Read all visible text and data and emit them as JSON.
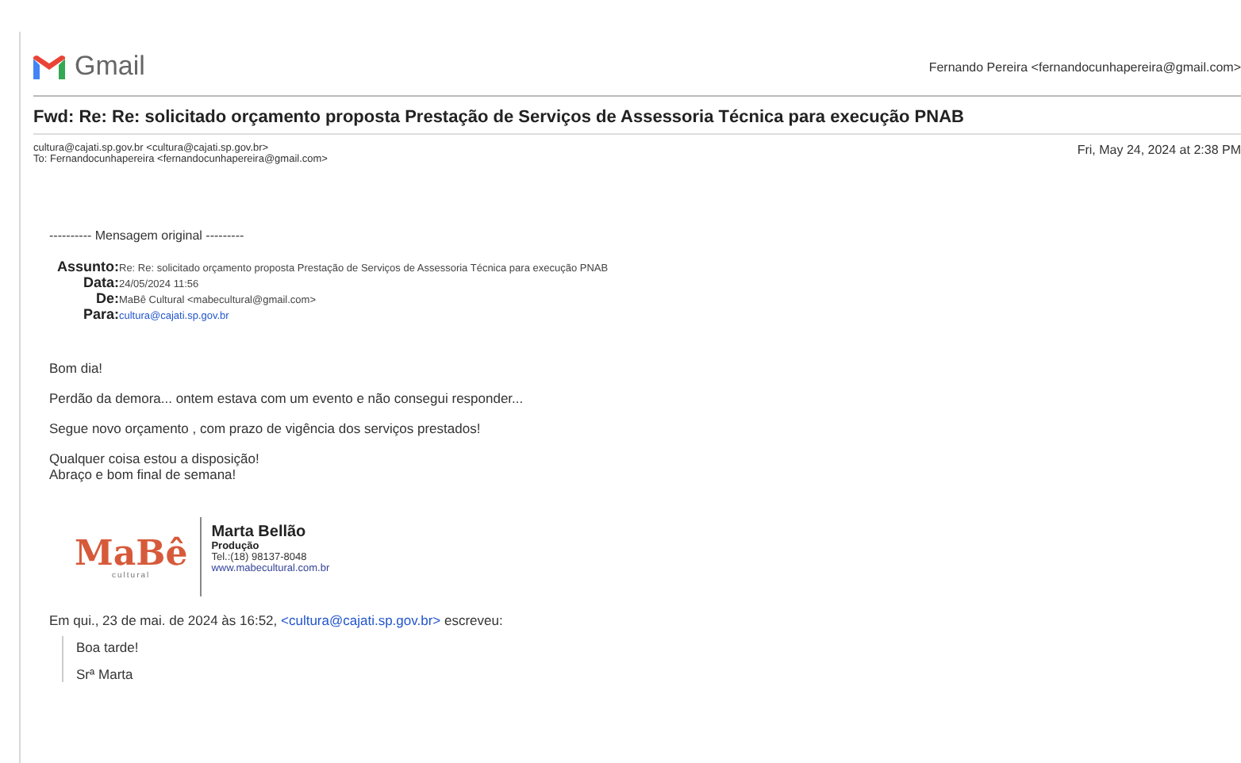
{
  "header": {
    "brand": "Gmail",
    "account": "Fernando Pereira <fernandocunhapereira@gmail.com>"
  },
  "subject": "Fwd: Re: Re: solicitado orçamento proposta Prestação de Serviços de Assessoria Técnica para execução PNAB",
  "message": {
    "from": "cultura@cajati.sp.gov.br <cultura@cajati.sp.gov.br>",
    "to": "To: Fernandocunhapereira <fernandocunhapereira@gmail.com>",
    "date": "Fri, May 24, 2024 at 2:38 PM"
  },
  "forwarded": {
    "separator": "---------- Mensagem original ---------",
    "fields": [
      {
        "label": "Assunto:",
        "value": "Re: Re: solicitado orçamento proposta Prestação de Serviços de Assessoria Técnica para execução PNAB",
        "kind": "text"
      },
      {
        "label": "Data:",
        "value": "24/05/2024 11:56",
        "kind": "text"
      },
      {
        "label": "De:",
        "value": "MaBê Cultural <mabecultural@gmail.com>",
        "kind": "text"
      },
      {
        "label": "Para:",
        "value": "cultura@cajati.sp.gov.br",
        "kind": "link"
      }
    ]
  },
  "body": [
    [
      "Bom dia!"
    ],
    [
      "Perdão da demora... ontem estava com um evento e não consegui responder..."
    ],
    [
      "Segue novo orçamento , com prazo de vigência dos serviços prestados!"
    ],
    [
      "Qualquer coisa estou a disposição!",
      "Abraço e bom final de semana!"
    ]
  ],
  "signature": {
    "logo": "MaBê",
    "logo_sub": "cultural",
    "name": "Marta Bellão",
    "role": "Produção",
    "phone": "Tel.:(18) 98137-8048",
    "website": "www.mabecultural.com.br"
  },
  "quote": {
    "intro_before": "Em qui., 23 de mai. de 2024 às 16:52, ",
    "intro_link": "<cultura@cajati.sp.gov.br>",
    "intro_after": " escreveu:",
    "lines": [
      "Boa tarde!",
      "Srª Marta"
    ]
  }
}
